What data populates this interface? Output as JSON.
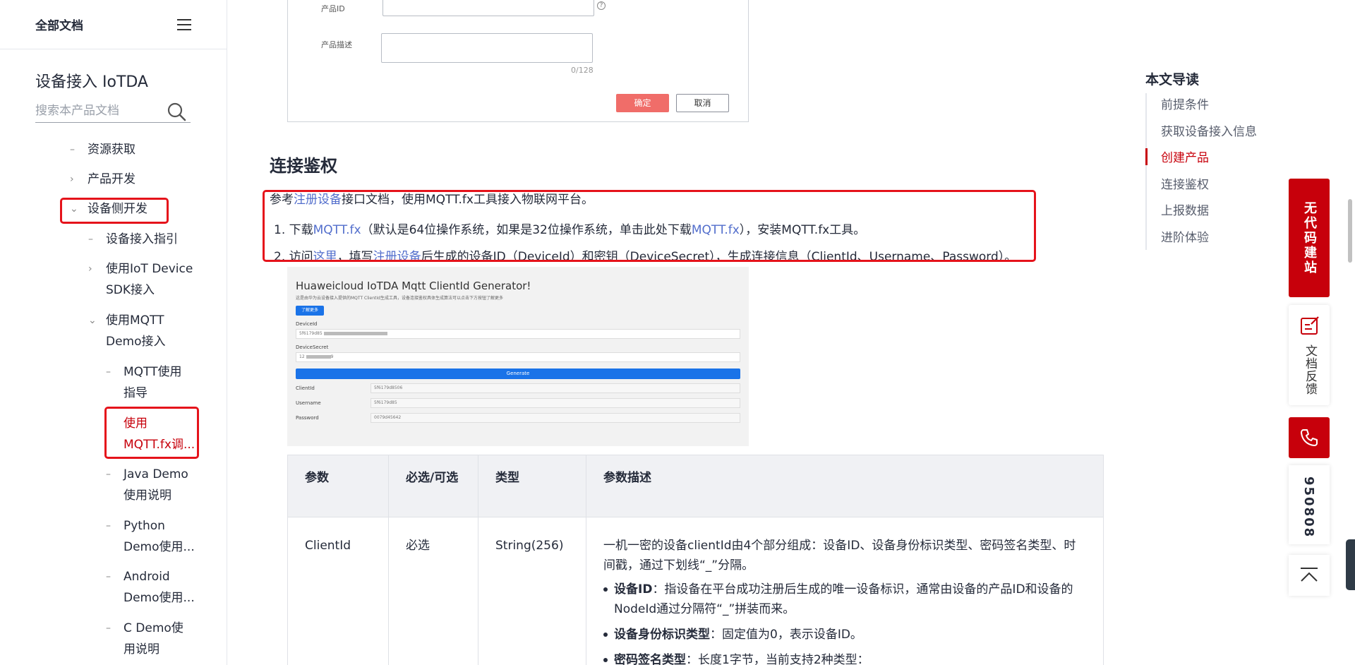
{
  "sidebar": {
    "header_title": "全部文档",
    "product_title": "设备接入 IoTDA",
    "search_placeholder": "搜索本产品文档",
    "items": [
      {
        "label": "资源获取"
      },
      {
        "label": "产品开发"
      },
      {
        "label": "设备侧开发"
      },
      {
        "label": "设备接入指引"
      },
      {
        "label_line1": "使用IoT Device",
        "label_line2": "SDK接入"
      },
      {
        "label_line1": "使用MQTT",
        "label_line2": "Demo接入"
      },
      {
        "label_line1": "MQTT使用",
        "label_line2": "指导"
      },
      {
        "label_line1": "使用",
        "label_line2": "MQTT.fx调..."
      },
      {
        "label_line1": "Java Demo",
        "label_line2": "使用说明"
      },
      {
        "label_line1": "Python",
        "label_line2": "Demo使用..."
      },
      {
        "label_line1": "Android",
        "label_line2": "Demo使用..."
      },
      {
        "label_line1": "C Demo使",
        "label_line2": "用说明"
      }
    ]
  },
  "form": {
    "product_id_label": "产品ID",
    "product_desc_label": "产品描述",
    "counter": "0/128",
    "ok_label": "确定",
    "cancel_label": "取消"
  },
  "section": {
    "title": "连接鉴权",
    "p1_pre": "参考",
    "p1_link": "注册设备",
    "p1_post": "接口文档，使用MQTT.fx工具接入物联网平台。",
    "s1_num": "1. 下载",
    "s1_link1": "MQTT.fx",
    "s1_mid": "（默认是64位操作系统，如果是32位操作系统，单击此处下载",
    "s1_link2": "MQTT.fx",
    "s1_post": "），安装MQTT.fx工具。",
    "s2_num": "2. 访问",
    "s2_link1": "这里",
    "s2_mid": "，填写",
    "s2_link2": "注册设备",
    "s2_post": "后生成的设备ID（DeviceId）和密钥（DeviceSecret），生成连接信息（ClientId、Username、Password）。"
  },
  "generator": {
    "title": "Huaweicloud IoTDA Mqtt ClientId Generator!",
    "subtitle": "这是由华为云设备接入提供的MQTT ClientId生成工具，设备连接鉴权具体生成算法可以点击下方按钮了解更多",
    "learn_more": "了解更多",
    "device_id_label": "DeviceId",
    "device_id_value": "5f6179d85",
    "device_secret_label": "DeviceSecret",
    "device_secret_value": "12",
    "device_secret_tail": "9",
    "generate_label": "Generate",
    "clientid_label": "ClientId",
    "clientid_value": "5f6179d85",
    "clientid_tail": "06",
    "username_label": "Username",
    "username_value": "5f6179d85",
    "password_label": "Password",
    "password_value": "0079d456",
    "password_tail": "42"
  },
  "table": {
    "headers": [
      "参数",
      "必选/可选",
      "类型",
      "参数描述"
    ],
    "row": {
      "param": "ClientId",
      "required": "必选",
      "type": "String(256)",
      "desc": "一机一密的设备clientId由4个部分组成：设备ID、设备身份标识类型、密码签名类型、时间戳，通过下划线“_”分隔。",
      "b1_key": "设备ID",
      "b1_val": "：指设备在平台成功注册后生成的唯一设备标识，通常由设备的产品ID和设备的NodeId通过分隔符“_”拼装而来。",
      "b2_key": "设备身份标识类型",
      "b2_val": "：固定值为0，表示设备ID。",
      "b3_key": "密码签名类型",
      "b3_val": "：长度1字节，当前支持2种类型："
    }
  },
  "toc": {
    "title": "本文导读",
    "items": [
      "前提条件",
      "获取设备接入信息",
      "创建产品",
      "连接鉴权",
      "上报数据",
      "进阶体验"
    ],
    "active_index": 2
  },
  "float": {
    "red_banner": "无代码建站",
    "feedback": "文档反馈",
    "hotline": "950808"
  },
  "colors": {
    "brand_red": "#c7000b",
    "link_blue": "#526ecc",
    "annotation_red": "#e5131b"
  }
}
